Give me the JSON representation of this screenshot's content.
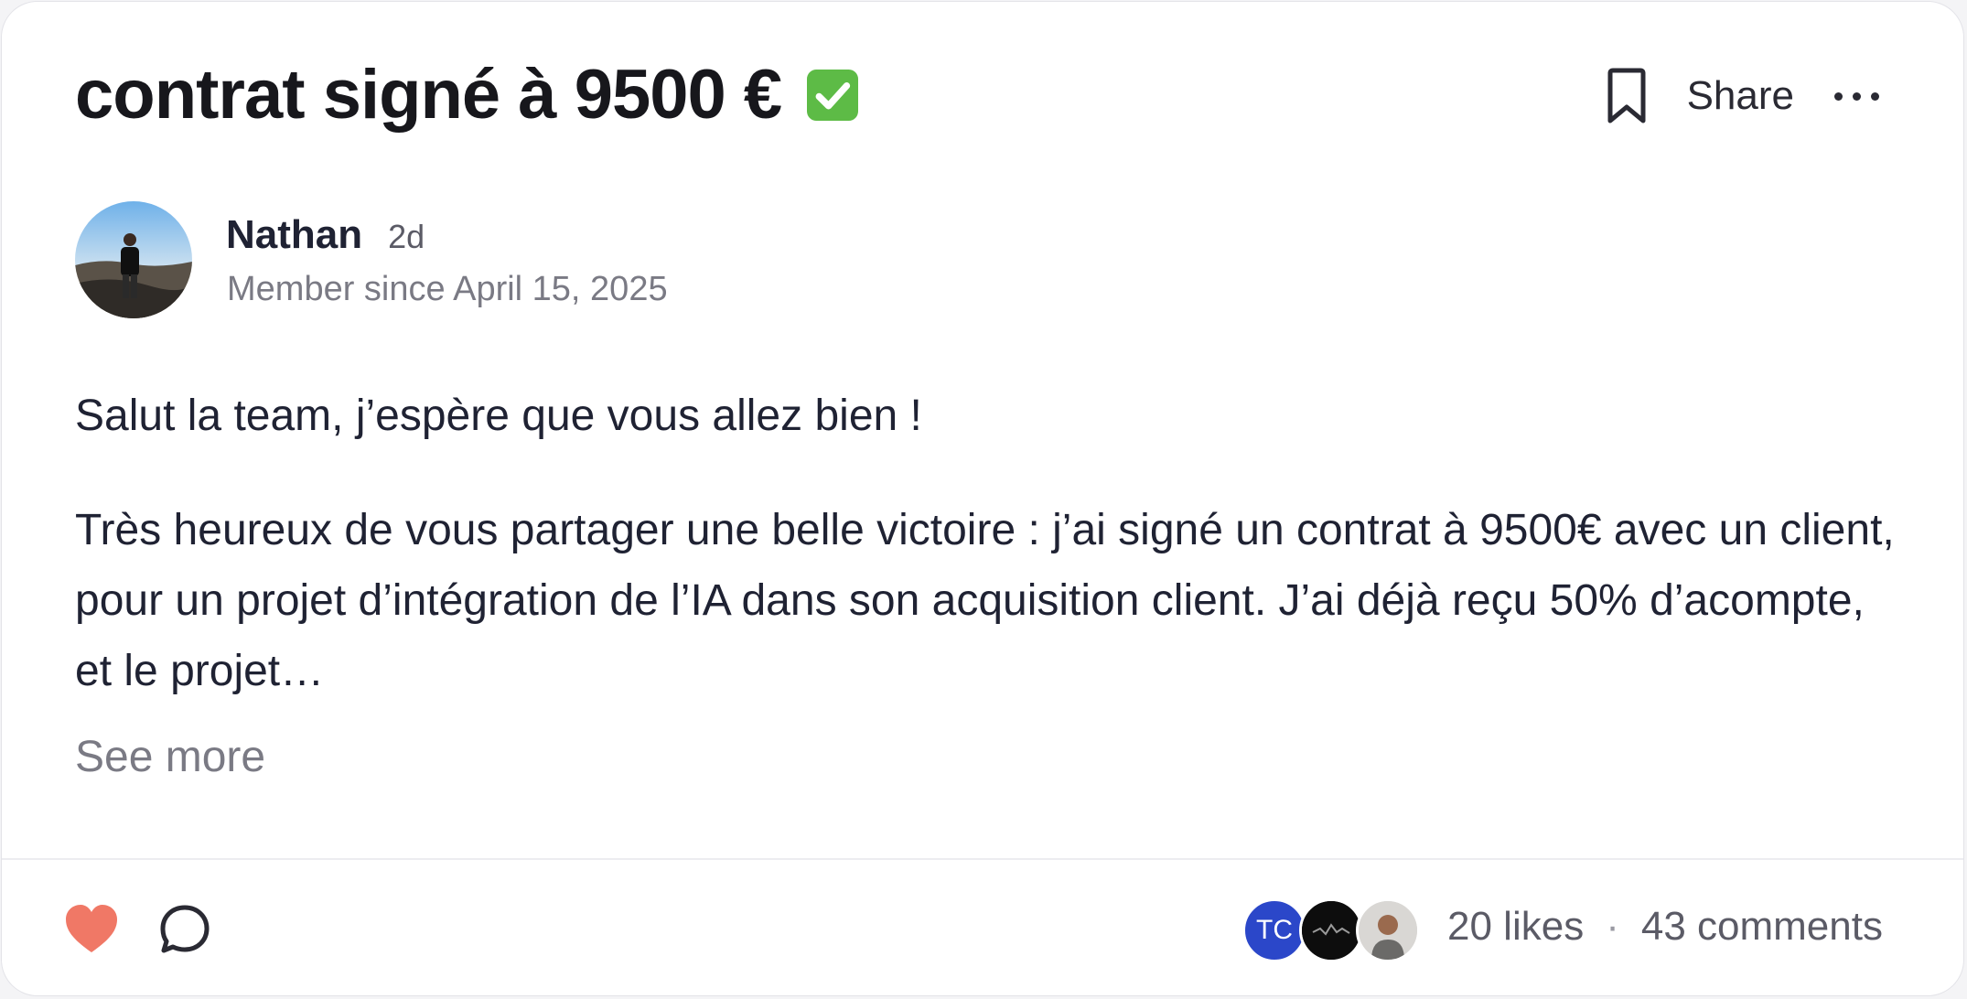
{
  "post": {
    "title": "contrat signé à 9500 €",
    "title_emoji": "white-check-mark-emoji",
    "author": {
      "name": "Nathan",
      "age": "2d",
      "member_since": "Member since April 15, 2025"
    },
    "body": [
      "Salut la team, j’espère que vous allez bien !",
      "Très heureux de vous partager une belle victoire : j’ai signé un contrat à 9500€ avec un client, pour un projet d’intégration de l’IA dans son acquisition client. J’ai déjà reçu 50% d’acompte, et le projet…"
    ],
    "see_more_label": "See more"
  },
  "header_actions": {
    "bookmark_icon": "bookmark-icon",
    "share_label": "Share",
    "more_icon": "more-horizontal-icon"
  },
  "footer": {
    "like_icon": "heart-icon",
    "comment_icon": "comment-icon",
    "likers": [
      {
        "initials": "TC",
        "color": "#2b47c9"
      },
      {
        "initials": "",
        "color": "#0d0d0d"
      },
      {
        "initials": "",
        "color": "#d9d7d4"
      }
    ],
    "likes_label": "20 likes",
    "separator": "·",
    "comments_label": "43 comments"
  },
  "colors": {
    "heart": "#f07866",
    "check_emoji": "#5dbb46",
    "text_primary": "#1f2233",
    "text_muted": "#7a7a84"
  }
}
